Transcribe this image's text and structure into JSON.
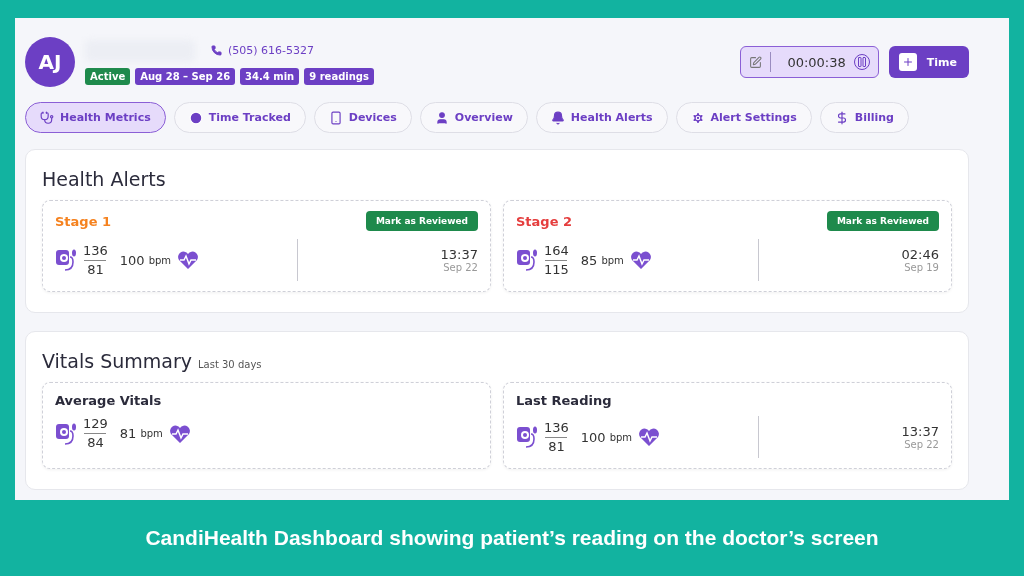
{
  "patient": {
    "initials": "AJ",
    "phone": "(505) 616-5327",
    "badges": [
      {
        "text": "Active",
        "kind": "status"
      },
      {
        "text": "Aug 28 – Sep 26",
        "kind": "info"
      },
      {
        "text": "34.4 min",
        "kind": "info"
      },
      {
        "text": "9 readings",
        "kind": "info"
      }
    ]
  },
  "timer": {
    "time": "00:00:38"
  },
  "add_time_button": {
    "label": "Time"
  },
  "tabs": [
    {
      "label": "Health Metrics",
      "selected": true
    },
    {
      "label": "Time Tracked",
      "selected": false
    },
    {
      "label": "Devices",
      "selected": false
    },
    {
      "label": "Overview",
      "selected": false
    },
    {
      "label": "Health Alerts",
      "selected": false
    },
    {
      "label": "Alert Settings",
      "selected": false
    },
    {
      "label": "Billing",
      "selected": false
    }
  ],
  "health_alerts": {
    "title": "Health Alerts",
    "alerts": [
      {
        "stage": "Stage 1",
        "color": "#f5821f",
        "button": "Mark as Reviewed",
        "systolic": "136",
        "diastolic": "81",
        "pulse": "100",
        "unit": "bpm",
        "time": "13:37",
        "date": "Sep 22"
      },
      {
        "stage": "Stage 2",
        "color": "#e53e3e",
        "button": "Mark as Reviewed",
        "systolic": "164",
        "diastolic": "115",
        "pulse": "85",
        "unit": "bpm",
        "time": "02:46",
        "date": "Sep 19"
      }
    ]
  },
  "vitals_summary": {
    "title": "Vitals Summary",
    "subtitle": "Last 30 days",
    "cards": [
      {
        "title": "Average Vitals",
        "systolic": "129",
        "diastolic": "84",
        "pulse": "81",
        "unit": "bpm"
      },
      {
        "title": "Last Reading",
        "systolic": "136",
        "diastolic": "81",
        "pulse": "100",
        "unit": "bpm",
        "time": "13:37",
        "date": "Sep 22"
      }
    ]
  },
  "caption": "CandiHealth Dashboard showing patient’s reading on the doctor’s screen"
}
